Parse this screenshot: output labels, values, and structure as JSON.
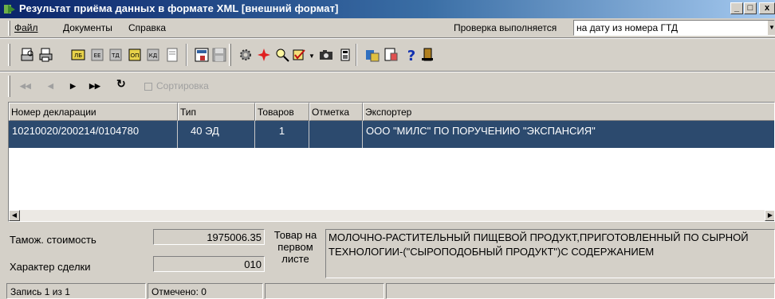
{
  "window": {
    "title": "Результат приёма данных в формате XML [внешний формат]",
    "controls": {
      "minimize": "_",
      "maximize": "□",
      "close": "x"
    }
  },
  "menu": {
    "items": [
      {
        "label": "Файл"
      },
      {
        "label": "Документы"
      },
      {
        "label": "Справка"
      }
    ],
    "check_label": "Проверка выполняется",
    "check_value": "на дату из номера ГТД"
  },
  "navbar": {
    "first": "◀◀",
    "prev": "◀",
    "next": "▶",
    "last": "▶▶",
    "refresh": "↻",
    "sort_label": "Сортировка"
  },
  "grid": {
    "columns": [
      "Номер декларации",
      "Тип",
      "Товаров",
      "Отметка",
      "Экспортер"
    ],
    "rows": [
      {
        "number": "10210020/200214/0104780",
        "type": "40 ЭД",
        "goods": "1",
        "mark": "",
        "exporter": "ООО \"МИЛС\" ПО ПОРУЧЕНИЮ \"ЭКСПАНСИЯ\""
      }
    ]
  },
  "details": {
    "customs_value_label": "Тамож. стоимость",
    "customs_value": "1975006.35",
    "deal_label": "Характер сделки",
    "deal_value": "010",
    "goods_first_sheet_label": "Товар на первом листе",
    "goods_description": "МОЛОЧНО-РАСТИТЕЛЬНЫЙ ПИЩЕВОЙ ПРОДУКТ,ПРИГОТОВЛЕННЫЙ ПО СЫРНОЙ ТЕХНОЛОГИИ-(\"СЫРОПОДОБНЫЙ ПРОДУКТ\")С СОДЕРЖАНИЕМ"
  },
  "status": {
    "record": "Запись 1 из 1",
    "marked": "Отмечено: 0"
  },
  "colors": {
    "selection": "#2c4a6e",
    "title_gradient_start": "#0a246a",
    "window_bg": "#d4d0c8"
  },
  "toolbar_icons": [
    "print-preview-icon",
    "print-icon",
    "doc-yellow-icon",
    "doc-grey-icon",
    "doc-grey2-icon",
    "doc-yellow2-icon",
    "doc-grey3-icon",
    "doc-page-icon",
    "form-icon",
    "save-icon",
    "gear-icon",
    "star-icon",
    "search-icon",
    "checkmark-icon",
    "camera-icon",
    "calc-icon",
    "export-icon",
    "import-icon",
    "help-icon",
    "exit-icon"
  ]
}
